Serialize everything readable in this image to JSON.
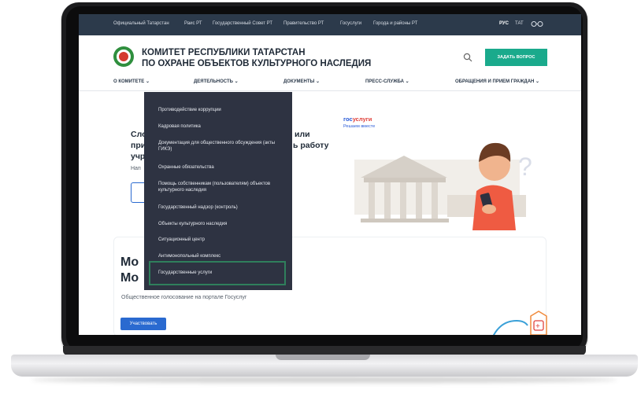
{
  "topbar": {
    "links": [
      "Официальный Татарстан",
      "Раис РТ",
      "Государственный Совет РТ",
      "Правительство РТ",
      "Госуслуги",
      "Города и районы РТ"
    ],
    "lang_ru": "РУС",
    "lang_tat": "ТАТ"
  },
  "header": {
    "org_line1": "КОМИТЕТ РЕСПУБЛИКИ ТАТАРСТАН",
    "org_line2": "ПО ОХРАНЕ ОБЪЕКТОВ КУЛЬТУРНОГО НАСЛЕДИЯ",
    "ask_button": "ЗАДАТЬ ВОПРОС"
  },
  "nav": [
    "О КОМИТЕТЕ",
    "ДЕЯТЕЛЬНОСТЬ",
    "ДОКУМЕНТЫ",
    "ПРЕСС-СЛУЖБА",
    "ОБРАЩЕНИЯ И ПРИЕМ ГРАЖДАН"
  ],
  "dropdown": [
    "Противодействие коррупции",
    "Кадровая политика",
    "Документация для общественного обсуждения (акты ГИКЭ)",
    "Охранные обязательства",
    "Помощь собственникам (пользователям) объектов культурного наследия",
    "Государственный надзор (контроль)",
    "Объекты культурного наследия",
    "Ситуационный центр",
    "Антимонопольный комплекс",
    "Государственные услуги"
  ],
  "hero": {
    "t1a": "Сло",
    "t1b": "или",
    "t2a": "при",
    "t2b": "ь работу",
    "t3": "учр",
    "t4": "Нап",
    "gos_a": "гос",
    "gos_b": "услуги",
    "gos_tag": "Решаем вместе"
  },
  "card": {
    "title1": "Мо",
    "title2": "Мо",
    "subtitle": "Общественное голосование на портале Госуслуг",
    "button": "Участвовать"
  },
  "colors": {
    "topbar": "#2c3a4b",
    "accent_green": "#1aaa8c",
    "blue": "#2a6ad0",
    "dropdown_bg": "#2e3342"
  }
}
